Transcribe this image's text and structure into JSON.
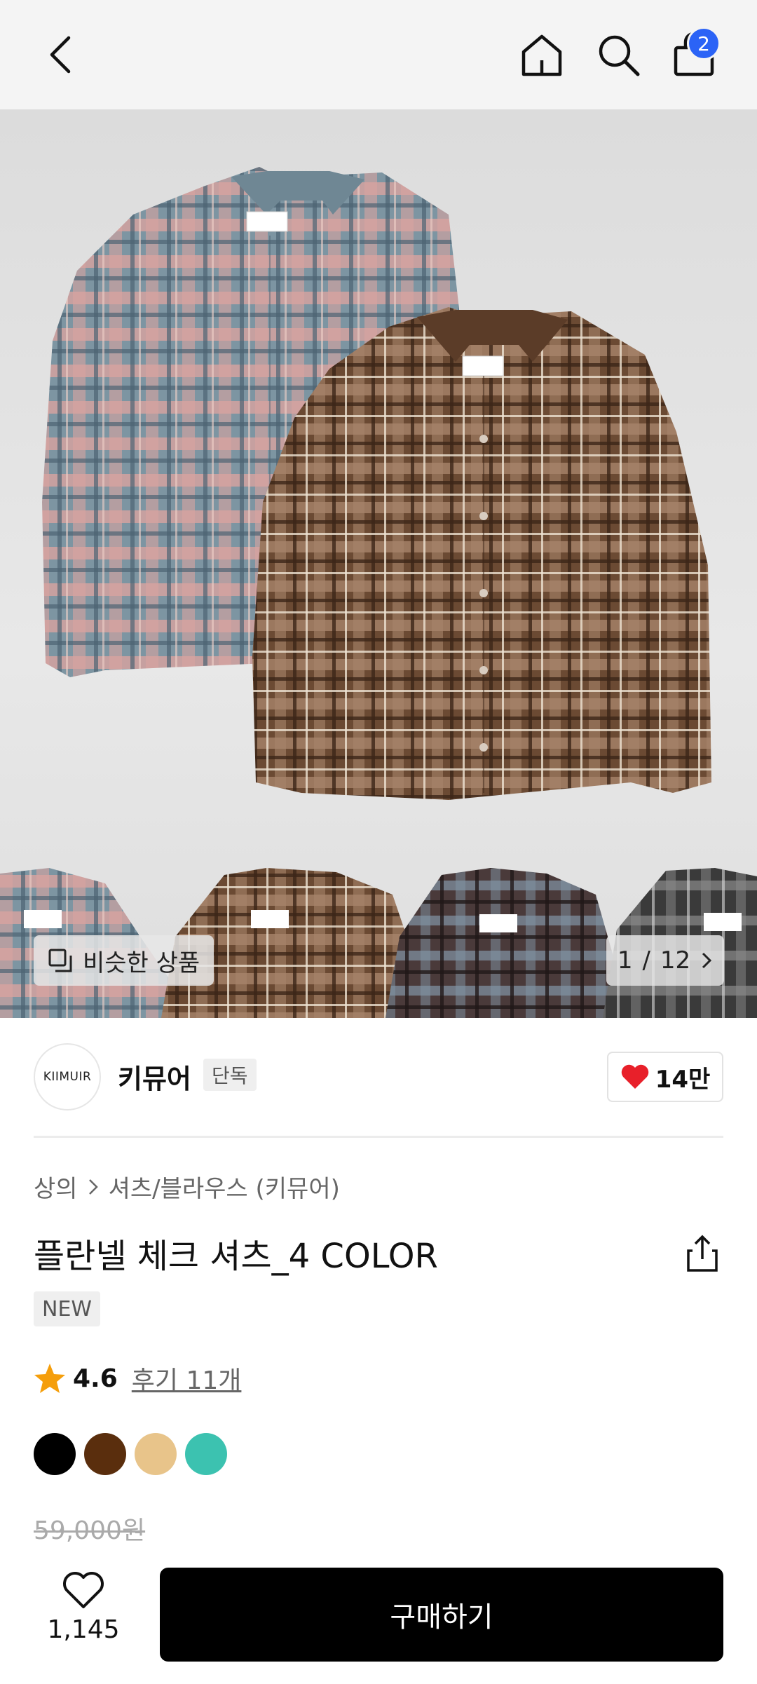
{
  "header": {
    "cart_count": "2",
    "icons": [
      "back-arrow-icon",
      "home-icon",
      "search-icon",
      "shopping-bag-icon"
    ]
  },
  "gallery": {
    "similar_label": "비슷한 상품",
    "page_current": "1",
    "page_separator": "/",
    "page_total": "12"
  },
  "brand": {
    "logo_text": "KIIMUIR",
    "name": "키뮤어",
    "exclusive_label": "단독",
    "likes": "14만"
  },
  "product": {
    "breadcrumb": [
      "상의",
      "셔츠/블라우스 (키뮤어)"
    ],
    "title": "플란넬 체크 셔츠_4 COLOR",
    "new_label": "NEW",
    "rating": "4.6",
    "reviews": "후기 11개",
    "colors": [
      "#000000",
      "#5a2e0d",
      "#e8c48a",
      "#3cc2b0"
    ],
    "original_price": "59,000원"
  },
  "bottom_bar": {
    "wish_count": "1,145",
    "buy_label": "구매하기"
  },
  "colors": {
    "accent_blue": "#2b63f6",
    "heart_red": "#e8202a",
    "star_orange": "#f59e0b"
  }
}
